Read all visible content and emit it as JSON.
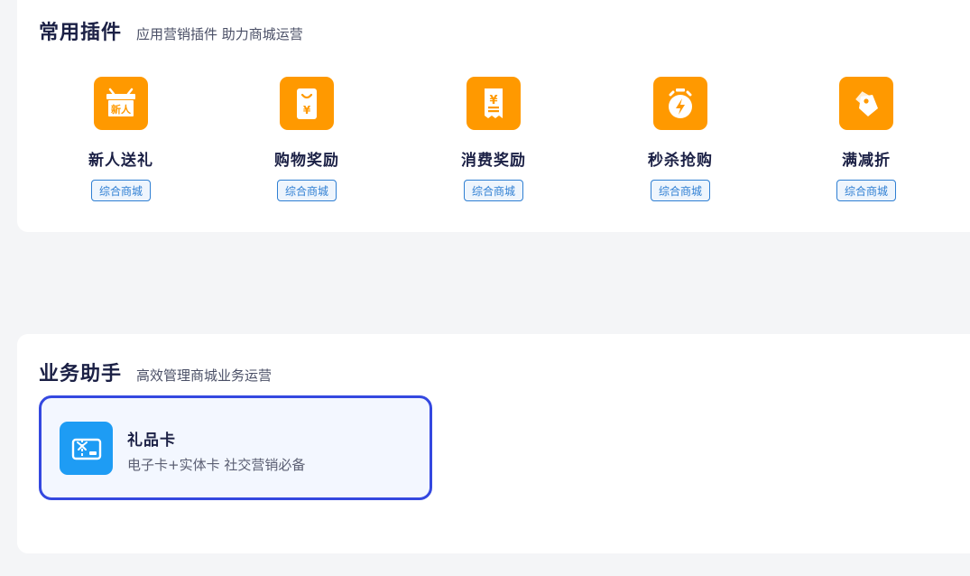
{
  "plugins_section": {
    "title": "常用插件",
    "subtitle": "应用营销插件 助力商城运营",
    "items": [
      {
        "name": "新人送礼",
        "tag": "综合商城",
        "icon": "new-user-gift-icon"
      },
      {
        "name": "购物奖励",
        "tag": "综合商城",
        "icon": "shopping-reward-icon"
      },
      {
        "name": "消费奖励",
        "tag": "综合商城",
        "icon": "consumption-receipt-icon"
      },
      {
        "name": "秒杀抢购",
        "tag": "综合商城",
        "icon": "flash-sale-timer-icon"
      },
      {
        "name": "满减折",
        "tag": "综合商城",
        "icon": "discount-tag-icon"
      }
    ]
  },
  "assistant_section": {
    "title": "业务助手",
    "subtitle": "高效管理商城业务运营",
    "gift_card": {
      "title": "礼品卡",
      "description": "电子卡+实体卡 社交营销必备",
      "icon": "gift-card-icon"
    }
  },
  "colors": {
    "plugin_icon_bg": "#ff9900",
    "tag_blue": "#2f7fd3",
    "gift_icon_bg": "#1e9cf4",
    "selected_border": "#3448e0"
  }
}
